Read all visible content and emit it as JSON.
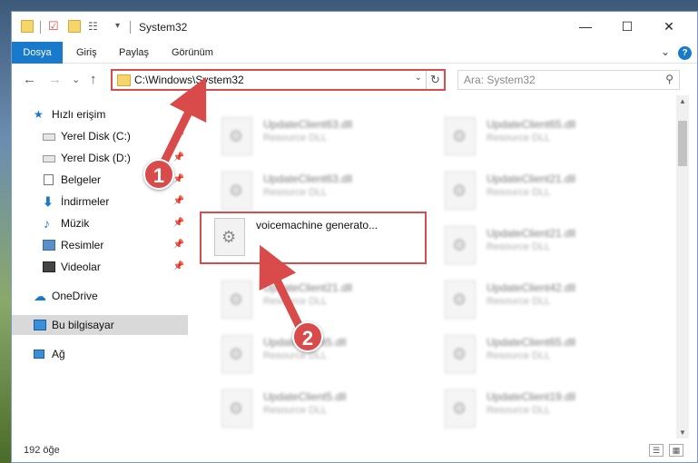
{
  "window": {
    "title": "System32",
    "controls": {
      "minimize": "—",
      "maximize": "☐",
      "close": "✕"
    }
  },
  "ribbon": {
    "tabs": [
      "Dosya",
      "Giriş",
      "Paylaş",
      "Görünüm"
    ],
    "expand": "⌄",
    "help": "?"
  },
  "nav": {
    "back": "←",
    "forward": "→",
    "recent": "⌄",
    "up": "↑",
    "address": "C:\\Windows\\System32",
    "address_dropdown": "⌄",
    "refresh": "↻",
    "search_placeholder": "Ara: System32",
    "search_icon": "⚲"
  },
  "sidebar": {
    "items": [
      {
        "label": "Hızlı erişim",
        "icon": "star-icon",
        "pinned": false
      },
      {
        "label": "Yerel Disk (C:)",
        "icon": "drive-icon",
        "pinned": true
      },
      {
        "label": "Yerel Disk (D:)",
        "icon": "drive-icon",
        "pinned": true
      },
      {
        "label": "Belgeler",
        "icon": "document-icon",
        "pinned": true
      },
      {
        "label": "İndirmeler",
        "icon": "download-icon",
        "pinned": true
      },
      {
        "label": "Müzik",
        "icon": "music-icon",
        "pinned": true
      },
      {
        "label": "Resimler",
        "icon": "pictures-icon",
        "pinned": true
      },
      {
        "label": "Videolar",
        "icon": "video-icon",
        "pinned": true
      },
      {
        "label": "OneDrive",
        "icon": "cloud-icon",
        "pinned": false
      },
      {
        "label": "Bu bilgisayar",
        "icon": "computer-icon",
        "pinned": false
      },
      {
        "label": "Ağ",
        "icon": "network-icon",
        "pinned": false
      }
    ],
    "pin_glyph": "📌"
  },
  "files": {
    "left": [
      {
        "name": "UpdateClient63.dll",
        "type": "Resource DLL"
      },
      {
        "name": "UpdateClient63.dll",
        "type": "Resource DLL"
      },
      {
        "name": "UpdateClient21.dll",
        "type": "Resource DLL"
      },
      {
        "name": "UpdateClient5.dll",
        "type": "Resource DLL"
      },
      {
        "name": "UpdateClient5.dll",
        "type": "Resource DLL"
      }
    ],
    "right": [
      {
        "name": "UpdateClient65.dll",
        "type": "Resource DLL"
      },
      {
        "name": "UpdateClient21.dll",
        "type": "Resource DLL"
      },
      {
        "name": "UpdateClient21.dll",
        "type": "Resource DLL"
      },
      {
        "name": "UpdateClient42.dll",
        "type": "Resource DLL"
      },
      {
        "name": "UpdateClient65.dll",
        "type": "Resource DLL"
      },
      {
        "name": "UpdateClient19.dll",
        "type": "Resource DLL"
      }
    ],
    "highlighted": {
      "name": "voicemachine generato..."
    }
  },
  "status": {
    "item_count": "192 öğe",
    "details_view": "☰",
    "tiles_view": "▦"
  },
  "annotations": {
    "step1": "1",
    "step2": "2",
    "color": "#d94a4a"
  }
}
